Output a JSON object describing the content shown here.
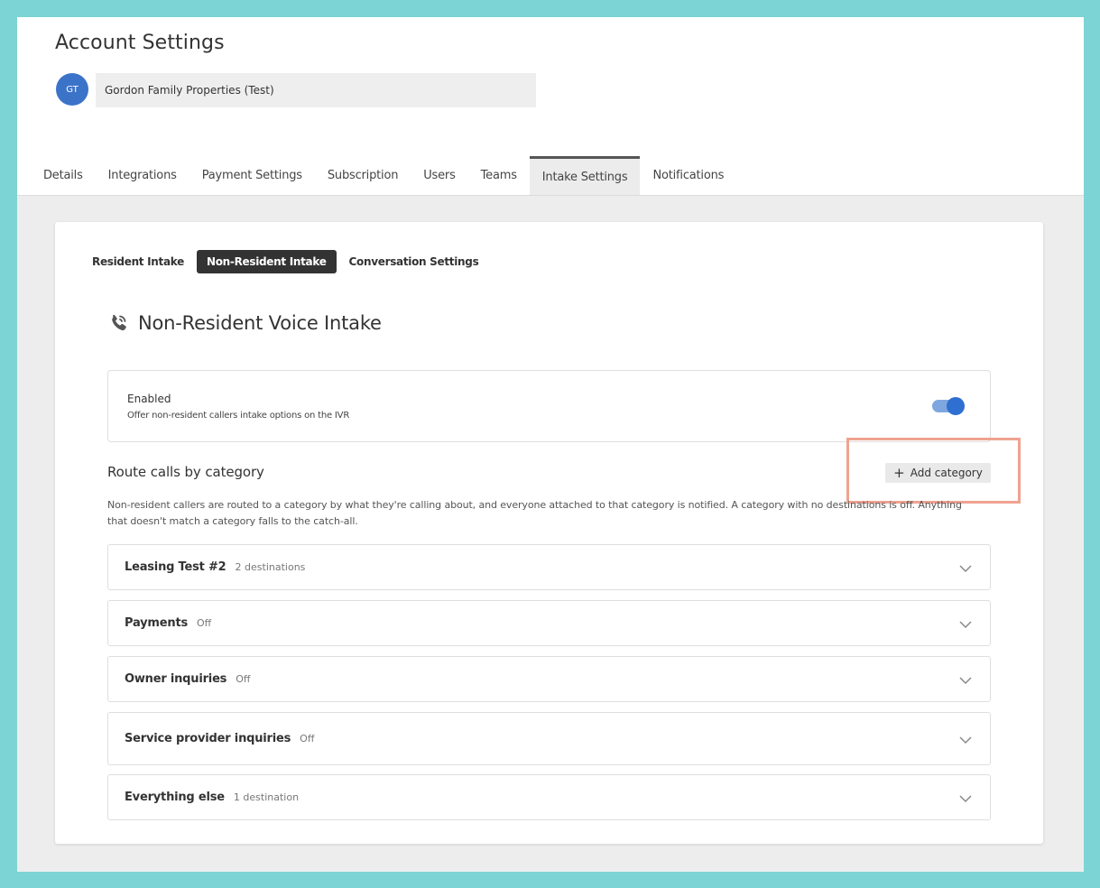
{
  "header": {
    "title": "Account Settings",
    "avatar_initials": "GT",
    "account_name": "Gordon Family Properties (Test)"
  },
  "tabs": [
    {
      "label": "Details"
    },
    {
      "label": "Integrations"
    },
    {
      "label": "Payment Settings"
    },
    {
      "label": "Subscription"
    },
    {
      "label": "Users"
    },
    {
      "label": "Teams"
    },
    {
      "label": "Intake Settings",
      "active": true
    },
    {
      "label": "Notifications"
    }
  ],
  "subtabs": [
    {
      "label": "Resident Intake"
    },
    {
      "label": "Non-Resident Intake",
      "active": true
    },
    {
      "label": "Conversation Settings"
    }
  ],
  "section": {
    "icon": "phone-ring-icon",
    "title": "Non-Resident Voice Intake"
  },
  "enabled_box": {
    "title": "Enabled",
    "description": "Offer non-resident callers intake options on the IVR",
    "toggle_on": true
  },
  "routing": {
    "title": "Route calls by category",
    "add_button": "Add category",
    "description": "Non-resident callers are routed to a category by what they're calling about, and everyone attached to that category is notified. A category with no destinations is off. Anything that doesn't match a category falls to the catch-all."
  },
  "categories": [
    {
      "name": "Leasing Test #2",
      "meta": "2 destinations"
    },
    {
      "name": "Payments",
      "meta": "Off"
    },
    {
      "name": "Owner inquiries",
      "meta": "Off"
    },
    {
      "name": "Service provider inquiries",
      "meta": "Off"
    },
    {
      "name": "Everything else",
      "meta": "1 destination"
    }
  ],
  "colors": {
    "background": "#7dd4d4",
    "accent": "#2f6fd1",
    "highlight": "#f0a292"
  }
}
